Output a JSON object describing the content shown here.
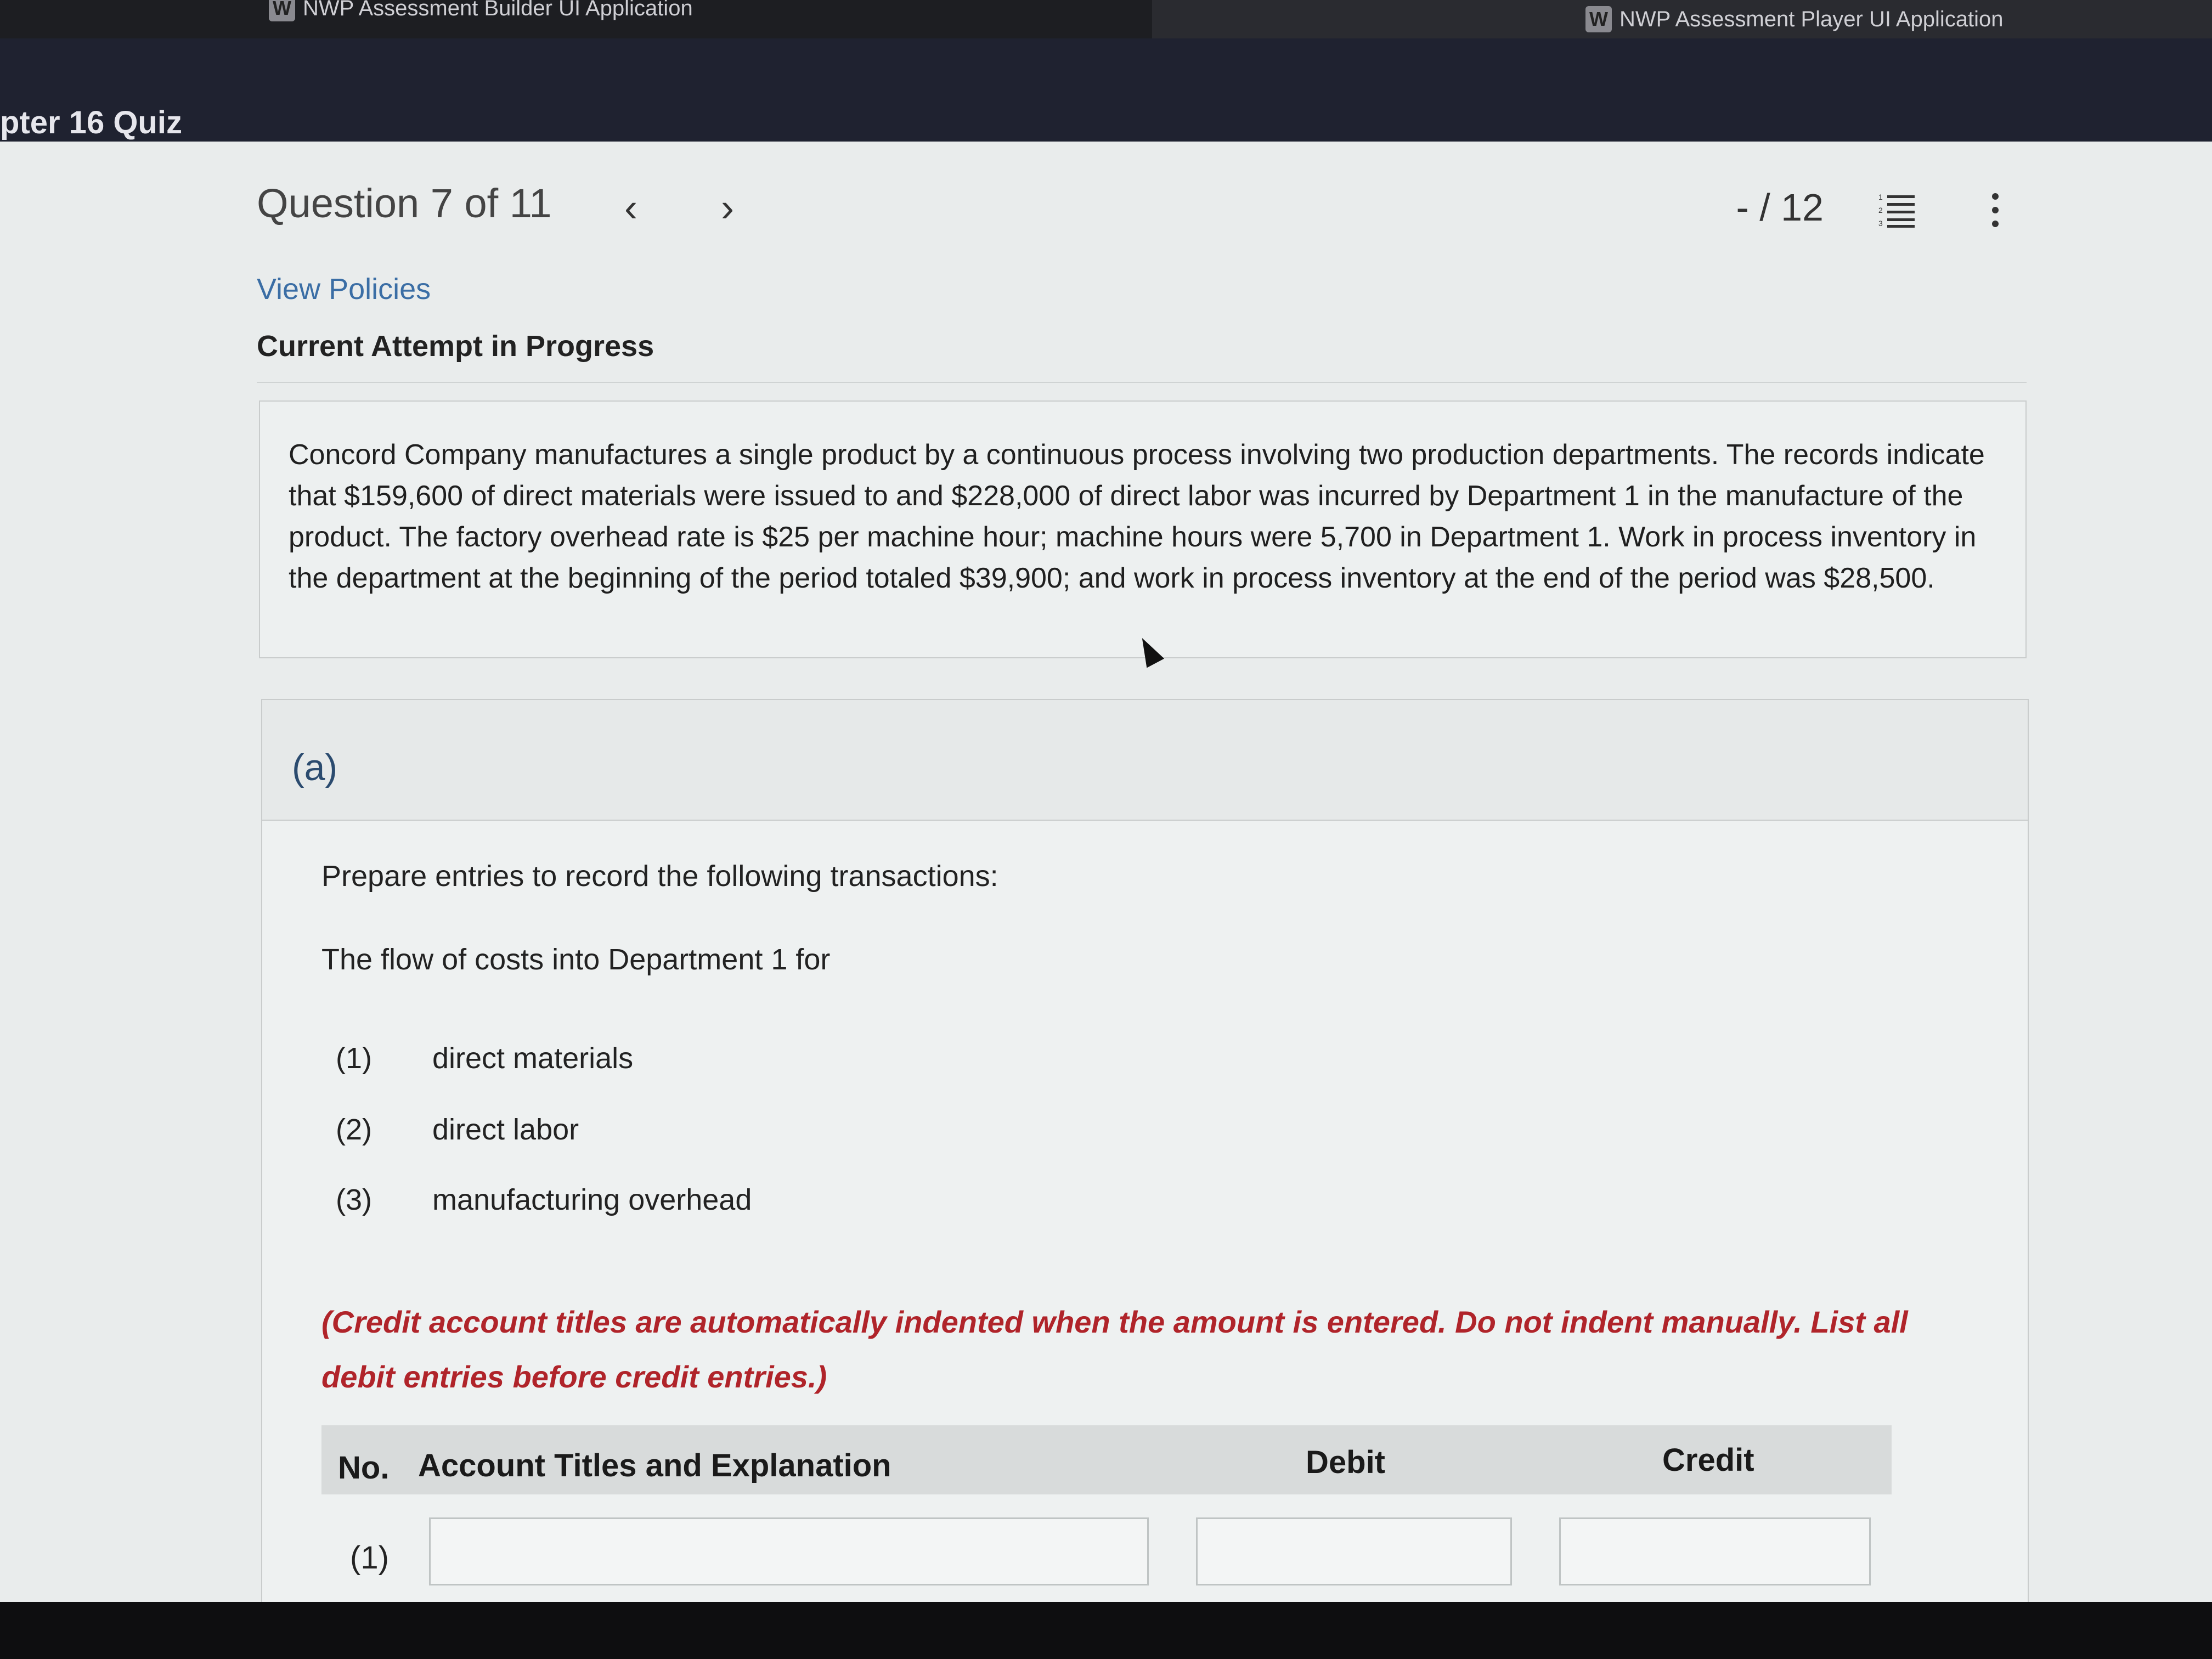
{
  "tabs": [
    {
      "icon": "W",
      "label": "NWP Assessment Builder UI Application"
    },
    {
      "icon": "W",
      "label": "NWP Assessment Player UI Application"
    }
  ],
  "quiz_title": "pter 16 Quiz",
  "question_nav": {
    "label": "Question 7 of 11",
    "prev_icon": "chevron-left-icon",
    "next_icon": "chevron-right-icon",
    "score": "- / 12",
    "list_icon": "numbered-list-icon",
    "menu_icon": "more-vertical-icon"
  },
  "view_policies": "View Policies",
  "attempt_status": "Current Attempt in Progress",
  "problem_text": "Concord Company manufactures a single product by a continuous process involving two production departments. The records indicate that $159,600 of direct materials were issued to and $228,000 of direct labor was incurred by Department 1 in the manufacture of the product. The factory overhead rate is $25 per machine hour; machine hours were 5,700 in Department 1. Work in process inventory in the department at the beginning of the period totaled $39,900; and work in process inventory at the end of the period was $28,500.",
  "part": {
    "label": "(a)",
    "instruction": "Prepare entries to record the following transactions:",
    "subinstruction": "The flow of costs into Department 1 for",
    "items": [
      {
        "num": "(1)",
        "text": "direct materials"
      },
      {
        "num": "(2)",
        "text": "direct labor"
      },
      {
        "num": "(3)",
        "text": "manufacturing overhead"
      }
    ],
    "note": "(Credit account titles are automatically indented when the amount is entered. Do not indent manually. List all debit entries before credit entries.)"
  },
  "table": {
    "headers": {
      "no": "No.",
      "account": "Account Titles and Explanation",
      "debit": "Debit",
      "credit": "Credit"
    },
    "rows": [
      {
        "no": "(1)",
        "account": "",
        "debit": "",
        "credit": ""
      }
    ]
  },
  "colors": {
    "link": "#3b6ea5",
    "note": "#b0242a",
    "header_bg": "#1f2230"
  }
}
